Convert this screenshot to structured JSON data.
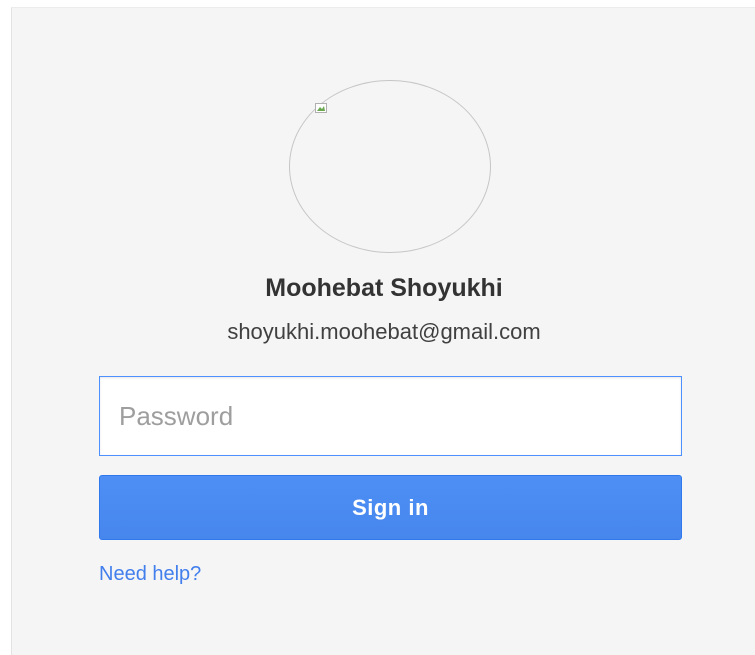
{
  "profile": {
    "name": "Moohebat Shoyukhi",
    "email": "shoyukhi.moohebat@gmail.com"
  },
  "password": {
    "value": "",
    "placeholder": "Password"
  },
  "signin_button": {
    "label": "Sign in"
  },
  "help_link": {
    "label": "Need help?"
  },
  "colors": {
    "accent": "#4787ed",
    "link": "#427fed",
    "background": "#f5f5f5"
  }
}
